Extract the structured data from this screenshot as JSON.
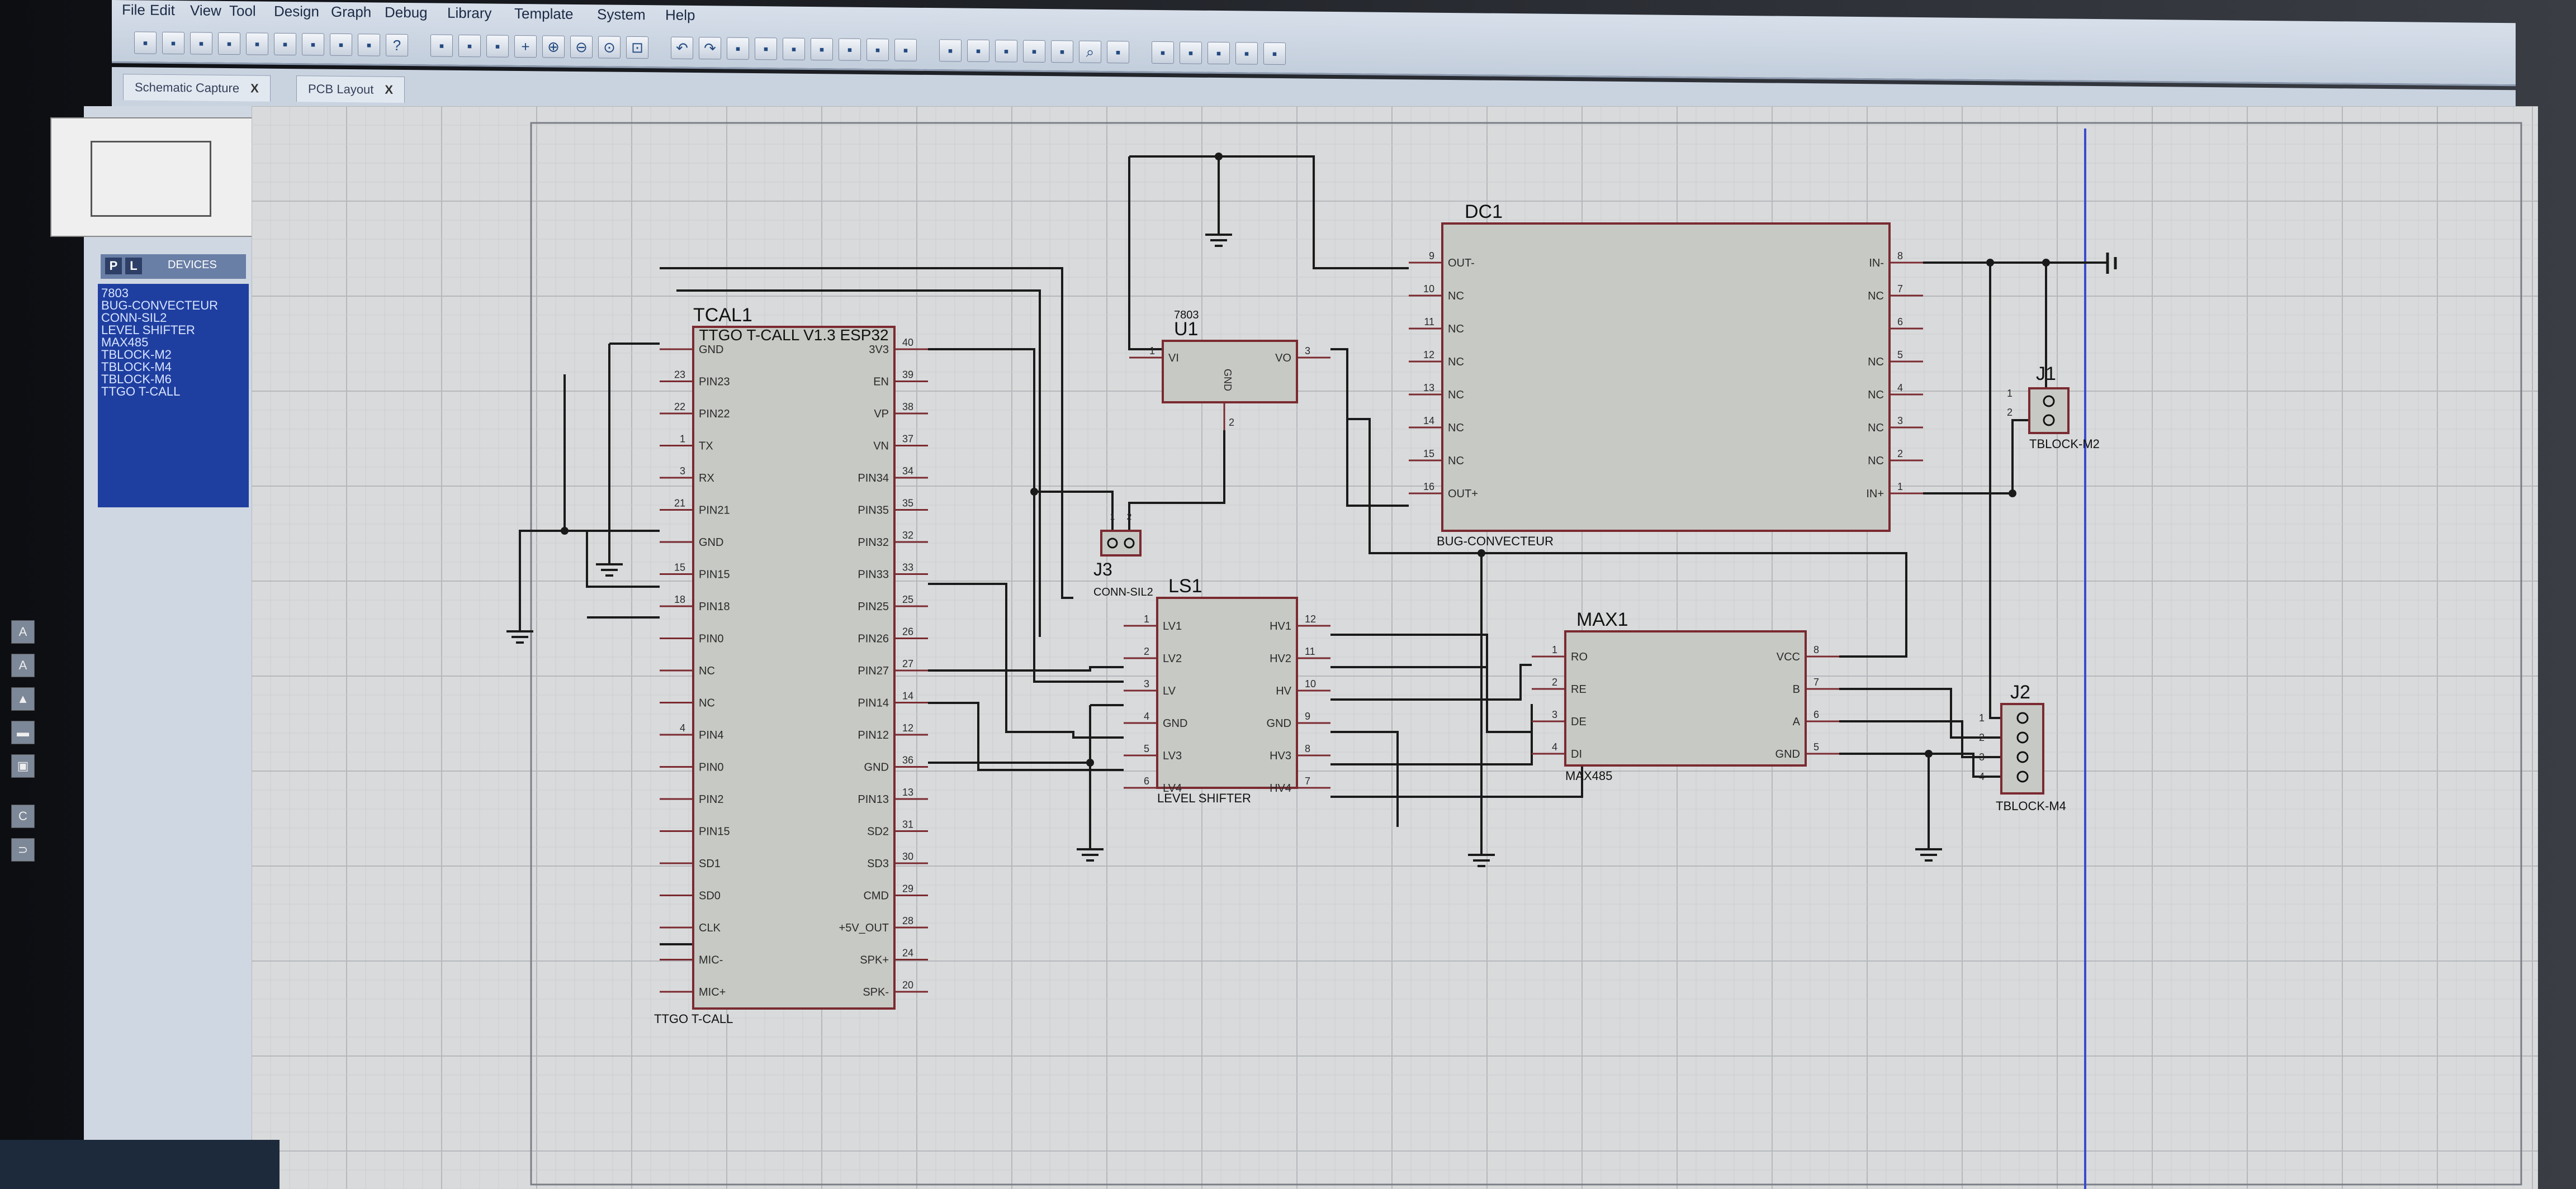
{
  "menu": [
    "File",
    "Edit",
    "View",
    "Tool",
    "Design",
    "Graph",
    "Debug",
    "Library",
    "Template",
    "System",
    "Help"
  ],
  "toolbar_icons": [
    "new-icon",
    "open-icon",
    "save-icon",
    "import-icon",
    "export-icon",
    "print-icon",
    "cut-icon",
    "copy-icon",
    "paste-icon",
    "help-icon",
    "grid-icon",
    "origin-icon",
    "pan-icon",
    "plus-icon",
    "zoom-in-icon",
    "zoom-out-icon",
    "zoom-all-icon",
    "zoom-area-icon",
    "undo-icon",
    "redo-icon",
    "cut-icon",
    "copy-icon",
    "paste-icon",
    "block-copy-icon",
    "block-move-icon",
    "block-rotate-icon",
    "block-delete-icon",
    "pick-device-icon",
    "make-device-icon",
    "packaging-icon",
    "decompose-icon",
    "wire-autorouter-icon",
    "search-icon",
    "property-tool-icon",
    "new-sheet-icon",
    "remove-sheet-icon",
    "bom-icon",
    "netlist-icon",
    "report-icon"
  ],
  "tabs": [
    {
      "label": "Schematic Capture",
      "close": "X"
    },
    {
      "label": "PCB Layout",
      "close": "X"
    }
  ],
  "devices_panel": {
    "tag_p": "P",
    "tag_l": "L",
    "title": "DEVICES",
    "items": [
      "7803",
      "BUG-CONVECTEUR",
      "CONN-SIL2",
      "LEVEL SHIFTER",
      "MAX485",
      "TBLOCK-M2",
      "TBLOCK-M4",
      "TBLOCK-M6",
      "TTGO T-CALL"
    ]
  },
  "side_icons": [
    "A",
    "A",
    "▲",
    "▬",
    "▣",
    "C",
    "⊃"
  ],
  "components": {
    "tcal": {
      "ref": "TCAL1",
      "title": "TTGO T-CALL V1.3 ESP32",
      "footer": "TTGO T-CALL",
      "left_pins": [
        {
          "num": "",
          "name": "GND"
        },
        {
          "num": "23",
          "name": "PIN23"
        },
        {
          "num": "22",
          "name": "PIN22"
        },
        {
          "num": "1",
          "name": "TX"
        },
        {
          "num": "3",
          "name": "RX"
        },
        {
          "num": "21",
          "name": "PIN21"
        },
        {
          "num": "",
          "name": "GND"
        },
        {
          "num": "15",
          "name": "PIN15"
        },
        {
          "num": "18",
          "name": "PIN18"
        },
        {
          "num": "",
          "name": "PIN0"
        },
        {
          "num": "",
          "name": "NC"
        },
        {
          "num": "",
          "name": "NC"
        },
        {
          "num": "4",
          "name": "PIN4"
        },
        {
          "num": "",
          "name": "PIN0"
        },
        {
          "num": "",
          "name": "PIN2"
        },
        {
          "num": "",
          "name": "PIN15"
        },
        {
          "num": "",
          "name": "SD1"
        },
        {
          "num": "",
          "name": "SD0"
        },
        {
          "num": "",
          "name": "CLK"
        },
        {
          "num": "",
          "name": "MIC-"
        },
        {
          "num": "",
          "name": "MIC+"
        }
      ],
      "right_pins": [
        {
          "num": "40",
          "name": "3V3"
        },
        {
          "num": "39",
          "name": "EN"
        },
        {
          "num": "38",
          "name": "VP"
        },
        {
          "num": "37",
          "name": "VN"
        },
        {
          "num": "34",
          "name": "PIN34"
        },
        {
          "num": "35",
          "name": "PIN35"
        },
        {
          "num": "32",
          "name": "PIN32"
        },
        {
          "num": "33",
          "name": "PIN33"
        },
        {
          "num": "25",
          "name": "PIN25"
        },
        {
          "num": "26",
          "name": "PIN26"
        },
        {
          "num": "27",
          "name": "PIN27"
        },
        {
          "num": "14",
          "name": "PIN14"
        },
        {
          "num": "12",
          "name": "PIN12"
        },
        {
          "num": "36",
          "name": "GND"
        },
        {
          "num": "13",
          "name": "PIN13"
        },
        {
          "num": "31",
          "name": "SD2"
        },
        {
          "num": "30",
          "name": "SD3"
        },
        {
          "num": "29",
          "name": "CMD"
        },
        {
          "num": "28",
          "name": "+5V_OUT"
        },
        {
          "num": "24",
          "name": "SPK+"
        },
        {
          "num": "20",
          "name": "SPK-"
        }
      ]
    },
    "u1": {
      "ref": "U1",
      "part": "7803",
      "vi": "VI",
      "vo": "VO",
      "gnd": "GND",
      "pin_vi": "1",
      "pin_vo": "3",
      "pin_gnd": "2"
    },
    "j3": {
      "ref": "J3",
      "part": "CONN-SIL2",
      "pins": [
        "1",
        "2"
      ]
    },
    "dc1": {
      "ref": "DC1",
      "part": "BUG-CONVECTEUR",
      "left_pins": [
        {
          "num": "9",
          "name": "OUT-"
        },
        {
          "num": "10",
          "name": "NC"
        },
        {
          "num": "11",
          "name": "NC"
        },
        {
          "num": "12",
          "name": "NC"
        },
        {
          "num": "13",
          "name": "NC"
        },
        {
          "num": "14",
          "name": "NC"
        },
        {
          "num": "15",
          "name": "NC"
        },
        {
          "num": "16",
          "name": "OUT+"
        }
      ],
      "right_pins": [
        {
          "num": "8",
          "name": "IN-"
        },
        {
          "num": "7",
          "name": "NC"
        },
        {
          "num": "6",
          "name": ""
        },
        {
          "num": "5",
          "name": "NC"
        },
        {
          "num": "4",
          "name": "NC"
        },
        {
          "num": "3",
          "name": "NC"
        },
        {
          "num": "2",
          "name": "NC"
        },
        {
          "num": "1",
          "name": "IN+"
        }
      ]
    },
    "j1": {
      "ref": "J1",
      "part": "TBLOCK-M2",
      "pins": [
        "1",
        "2"
      ]
    },
    "ls1": {
      "ref": "LS1",
      "part": "LEVEL SHIFTER",
      "left_pins": [
        {
          "num": "1",
          "name": "LV1"
        },
        {
          "num": "2",
          "name": "LV2"
        },
        {
          "num": "3",
          "name": "LV"
        },
        {
          "num": "4",
          "name": "GND"
        },
        {
          "num": "5",
          "name": "LV3"
        },
        {
          "num": "6",
          "name": "LV4"
        }
      ],
      "right_pins": [
        {
          "num": "12",
          "name": "HV1"
        },
        {
          "num": "11",
          "name": "HV2"
        },
        {
          "num": "10",
          "name": "HV"
        },
        {
          "num": "9",
          "name": "GND"
        },
        {
          "num": "8",
          "name": "HV3"
        },
        {
          "num": "7",
          "name": "HV4"
        }
      ]
    },
    "max1": {
      "ref": "MAX1",
      "part": "MAX485",
      "left_pins": [
        {
          "num": "1",
          "name": "RO"
        },
        {
          "num": "2",
          "name": "RE"
        },
        {
          "num": "3",
          "name": "DE"
        },
        {
          "num": "4",
          "name": "DI"
        }
      ],
      "right_pins": [
        {
          "num": "8",
          "name": "VCC"
        },
        {
          "num": "7",
          "name": "B"
        },
        {
          "num": "6",
          "name": "A"
        },
        {
          "num": "5",
          "name": "GND"
        }
      ]
    },
    "j2": {
      "ref": "J2",
      "part": "TBLOCK-M4",
      "pins": [
        "1",
        "2",
        "3",
        "4"
      ]
    }
  },
  "colors": {
    "wire": "#1a1a1a",
    "component_outline": "#7a2a30",
    "component_fill": "#c7c9c4",
    "pin_text": "#2a2a2a",
    "sheet_border": "#3b4bd0",
    "grid_major": "#b5b8bc",
    "grid_minor": "#cacdd0"
  }
}
